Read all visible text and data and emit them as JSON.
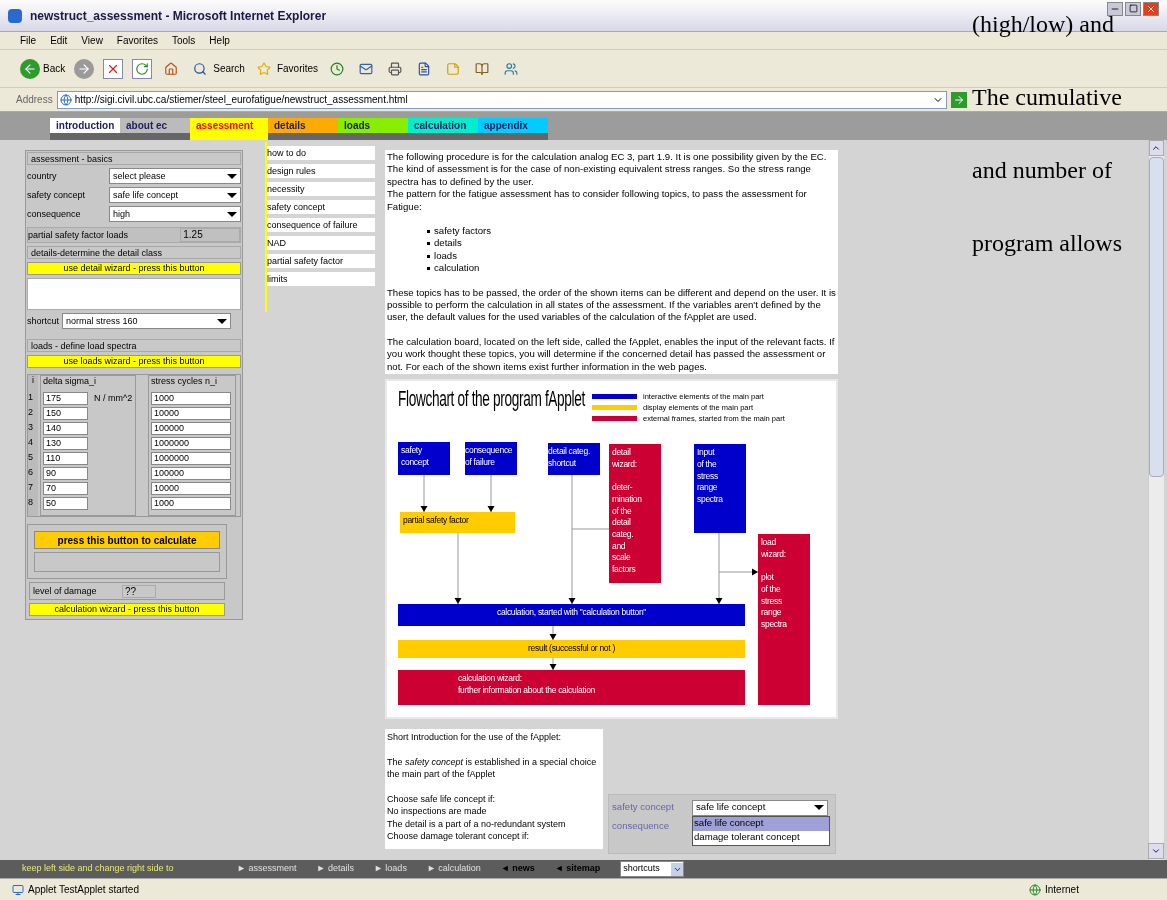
{
  "window": {
    "title": "newstruct_assessment - Microsoft Internet Explorer"
  },
  "menu": [
    "File",
    "Edit",
    "View",
    "Favorites",
    "Tools",
    "Help"
  ],
  "toolbar": [
    {
      "kind": "back",
      "label": "Back"
    },
    {
      "kind": "forward"
    },
    {
      "kind": "stop"
    },
    {
      "kind": "refresh"
    },
    {
      "kind": "home"
    },
    {
      "kind": "search",
      "label": "Search"
    },
    {
      "kind": "favorites",
      "label": "Favorites"
    },
    {
      "kind": "history"
    },
    {
      "kind": "mail"
    },
    {
      "kind": "print"
    },
    {
      "kind": "edit"
    },
    {
      "kind": "notes"
    },
    {
      "kind": "research"
    },
    {
      "kind": "messenger"
    }
  ],
  "address": {
    "label": "Address",
    "url": "http://sigi.civil.ubc.ca/stiemer/steel_eurofatigue/newstruct_assessment.html"
  },
  "overlay_text": [
    "(high/low) and",
    "The cumulative",
    "and number of",
    "program allows"
  ],
  "tabs": [
    {
      "label": "introduction",
      "color": "#ffffff",
      "selected": false
    },
    {
      "label": "about ec",
      "color": "#bbbbbb",
      "selected": false
    },
    {
      "label": "assessment",
      "color": "#ffff00",
      "selected": true
    },
    {
      "label": "details",
      "color": "#ffaa00",
      "selected": false
    },
    {
      "label": "loads",
      "color": "#88ee00",
      "selected": false
    },
    {
      "label": "calculation",
      "color": "#00eecc",
      "selected": false
    },
    {
      "label": "appendix",
      "color": "#00ccff",
      "selected": false
    }
  ],
  "basics": {
    "title": "assessment - basics",
    "fields": [
      {
        "label": "country",
        "value": "select please"
      },
      {
        "label": "safety concept",
        "value": "safe life concept"
      },
      {
        "label": "consequence",
        "value": "high"
      }
    ],
    "factor": {
      "label": "partial safety factor loads",
      "value": "1.25"
    }
  },
  "details": {
    "title": "details-determine the detail class",
    "wizard_button": "use detail wizard - press this button",
    "shortcut": {
      "label": "shortcut",
      "value": "normal stress 160"
    }
  },
  "loads": {
    "title": "loads - define load spectra",
    "wizard_button": "use loads wizard - press this button",
    "columns": [
      "i",
      "delta sigma_i",
      "stress cycles n_i"
    ],
    "unit": "N / mm^2",
    "rows": [
      {
        "i": "1",
        "sigma": "175",
        "cycles": "1000"
      },
      {
        "i": "2",
        "sigma": "150",
        "cycles": "10000"
      },
      {
        "i": "3",
        "sigma": "140",
        "cycles": "100000"
      },
      {
        "i": "4",
        "sigma": "130",
        "cycles": "1000000"
      },
      {
        "i": "5",
        "sigma": "110",
        "cycles": "1000000"
      },
      {
        "i": "6",
        "sigma": "90",
        "cycles": "100000"
      },
      {
        "i": "7",
        "sigma": "70",
        "cycles": "10000"
      },
      {
        "i": "8",
        "sigma": "50",
        "cycles": "1000"
      }
    ]
  },
  "calculation": {
    "button": "press this button to calculate",
    "damage": {
      "label": "level of damage",
      "value": "??"
    },
    "wizard_button": "calculation wizard - press this button"
  },
  "side_nav": [
    "how to do",
    "design rules",
    "necessity",
    "safety concept",
    "consequence of failure",
    "NAD",
    "partial safety factor",
    "limits"
  ],
  "intro": {
    "paragraphs_before": [
      "The following procedure is for the calculation analog EC 3, part 1.9. It is one possibility given by the EC. The kind of assessment is for the case of non-existing equivalent stress ranges. So the stress range spectra has to defined by the user.",
      "The pattern for the fatigue assessment has to consider following topics, to pass the assessment for Fatigue:"
    ],
    "bullets": [
      "safety factors",
      "details",
      "loads",
      "calculation"
    ],
    "paragraphs_after": [
      "These topics has to be passed, the order of the shown items can be different and depend on the user. It is possible to perform the calculation in all states of the assessment. If the variables aren't defined by the user, the default values for the used variables of the calculation of the fApplet are used.",
      "The calculation board, located on the left side, called the fApplet, enables the input of the relevant facts. If you work thought these topics, you will determine if the concerned detail has passed the assessment or not. For each of the shown items exist further information in the web pages."
    ]
  },
  "flowchart": {
    "title": "Flowchart of the program fApplet",
    "legend": [
      {
        "label": "interactive elements of the main part",
        "color": "#0000cc"
      },
      {
        "label": "display elements of the main part",
        "color": "#ffcc00"
      },
      {
        "label": "external frames, started from the main part",
        "color": "#cc0033"
      }
    ],
    "nodes": [
      {
        "text": "safety\nconcept",
        "kind": "interactive"
      },
      {
        "text": "consequence\nof failure",
        "kind": "interactive"
      },
      {
        "text": "detail categ.\nshortcut",
        "kind": "interactive"
      },
      {
        "text": "detail\nwizard:\n\ndeter-\nmination\nof the\ndetail\ncateg.\nand\nscale\nfactors",
        "kind": "external"
      },
      {
        "text": "Input\nof the\nstress\nrange\nspectra",
        "kind": "interactive"
      },
      {
        "text": "load\nwizard:\n\nplot\nof the\nstress\nrange\nspectra",
        "kind": "external"
      },
      {
        "text": "partial safety factor",
        "kind": "display"
      },
      {
        "text": "calculation, started with \"calculation button\"",
        "kind": "interactive"
      },
      {
        "text": "result (successful or not )",
        "kind": "display"
      },
      {
        "text": "calculation wizard:\nfurther information about the calculation",
        "kind": "external"
      }
    ]
  },
  "short_intro": [
    "Short Introduction for the use of the fApplet:",
    "The *safety concept* is established in a special choice the main part of the fApplet",
    "Choose safe life concept if:\nNo inspections are made\nThe detail is a part of a no-redundant system\nChoose damage tolerant concept if:"
  ],
  "applet_popup": {
    "fields": [
      {
        "label": "safety concept",
        "value": "safe life concept"
      },
      {
        "label": "consequence"
      }
    ],
    "options": [
      {
        "label": "safe life concept",
        "selected": true
      },
      {
        "label": "damage tolerant concept",
        "selected": false
      }
    ]
  },
  "bottom_nav": {
    "hint": "keep left side and change right side to",
    "links": [
      {
        "label": "assessment",
        "kind": "forward"
      },
      {
        "label": "details",
        "kind": "forward"
      },
      {
        "label": "loads",
        "kind": "forward"
      },
      {
        "label": "calculation",
        "kind": "forward"
      },
      {
        "label": "news",
        "kind": "back"
      },
      {
        "label": "sitemap",
        "kind": "back"
      }
    ],
    "arrows": {
      "forward": "►",
      "back": "◄"
    },
    "shortcuts": "shortcuts"
  },
  "status": {
    "text": "Applet TestApplet started",
    "zone": "Internet"
  }
}
